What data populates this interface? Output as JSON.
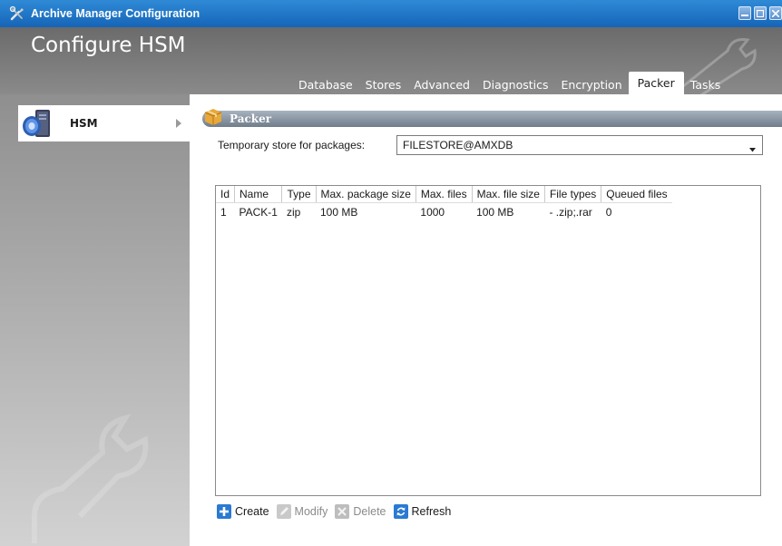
{
  "window": {
    "title": "Archive Manager Configuration",
    "app_icon": "tools-icon",
    "buttons": [
      "minimize-icon",
      "maximize-icon",
      "close-icon"
    ]
  },
  "header": {
    "title": "Configure HSM",
    "tabs": [
      {
        "label": "Database",
        "active": false
      },
      {
        "label": "Stores",
        "active": false
      },
      {
        "label": "Advanced",
        "active": false
      },
      {
        "label": "Diagnostics",
        "active": false
      },
      {
        "label": "Encryption",
        "active": false
      },
      {
        "label": "Packer",
        "active": true
      },
      {
        "label": "Tasks",
        "active": false
      }
    ]
  },
  "sidebar": {
    "items": [
      {
        "label": "HSM",
        "icon": "server-icon",
        "selected": true
      }
    ]
  },
  "main": {
    "section_title": "Packer",
    "store_label": "Temporary store for packages:",
    "store_value": "FILESTORE@AMXDB",
    "table": {
      "columns": [
        "Id",
        "Name",
        "Type",
        "Max. package size",
        "Max. files",
        "Max. file size",
        "File types",
        "Queued files"
      ],
      "rows": [
        [
          "1",
          "PACK-1",
          "zip",
          "100 MB",
          "1000",
          "100 MB",
          "- .zip;.rar",
          "0"
        ]
      ]
    },
    "toolbar": {
      "create": "Create",
      "modify": "Modify",
      "delete": "Delete",
      "refresh": "Refresh"
    }
  },
  "colors": {
    "titlebar": "#1f77c8",
    "header": "#7a7a7a",
    "accent_blue": "#2a7ad2"
  }
}
